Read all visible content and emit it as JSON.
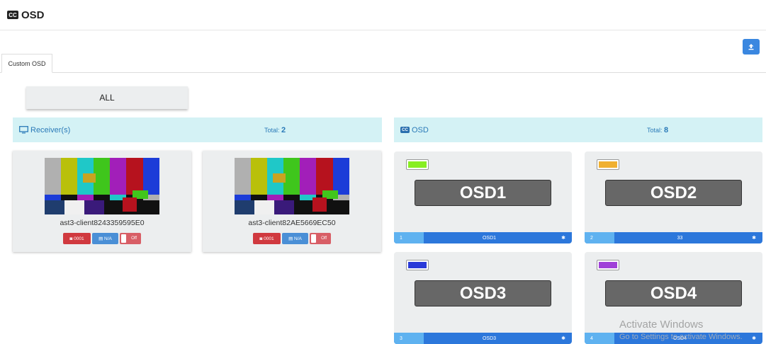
{
  "header": {
    "title": "OSD",
    "icon": "closed-caption-icon"
  },
  "toolbar": {
    "upload_icon": "upload-icon"
  },
  "tabs": [
    {
      "label": "Custom OSD"
    }
  ],
  "filter": {
    "all_label": "ALL"
  },
  "receivers": {
    "title": "Receiver(s)",
    "total_label": "Total:",
    "total": "2",
    "items": [
      {
        "name": "ast3-client8243359595E0",
        "id_badge": "0001",
        "osd_badge": "N/A",
        "toggle": "Off"
      },
      {
        "name": "ast3-client82AE5669EC50",
        "id_badge": "0001",
        "osd_badge": "N/A",
        "toggle": "Off"
      }
    ]
  },
  "osd": {
    "title": "OSD",
    "total_label": "Total:",
    "total": "8",
    "items": [
      {
        "label": "OSD1",
        "num": "1",
        "name": "OSD1",
        "color": "#88ee22"
      },
      {
        "label": "OSD2",
        "num": "2",
        "name": "33",
        "color": "#f0b030"
      },
      {
        "label": "OSD3",
        "num": "3",
        "name": "OSD3",
        "color": "#2a3ad8"
      },
      {
        "label": "OSD4",
        "num": "4",
        "name": "OSD4",
        "color": "#a040d8"
      }
    ]
  },
  "watermark": {
    "line1": "Activate Windows",
    "line2": "Go to Settings to activate Windows."
  },
  "colors": {
    "accent": "#2c77db",
    "section_bg": "#d4f2f5",
    "danger": "#d0393f"
  }
}
